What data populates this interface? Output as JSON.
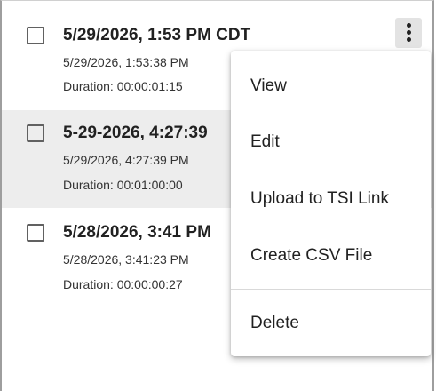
{
  "records": [
    {
      "title": "5/29/2026, 1:53 PM CDT",
      "timestamp": "5/29/2026, 1:53:38 PM",
      "duration": "Duration: 00:00:01:15"
    },
    {
      "title": "5-29-2026, 4:27:39",
      "timestamp": "5/29/2026, 4:27:39 PM",
      "duration": "Duration: 00:01:00:00"
    },
    {
      "title": "5/28/2026, 3:41 PM",
      "timestamp": "5/28/2026, 3:41:23 PM",
      "duration": "Duration: 00:00:00:27"
    }
  ],
  "menu": {
    "items": [
      "View",
      "Edit",
      "Upload to TSI Link",
      "Create CSV File",
      "Delete"
    ]
  },
  "icons": {
    "more": "more-vertical-icon",
    "checkbox": "checkbox-unchecked-icon"
  },
  "colors": {
    "highlight_row": "#ededed",
    "text": "#212121",
    "kebab_bg": "#e3e3e3"
  }
}
